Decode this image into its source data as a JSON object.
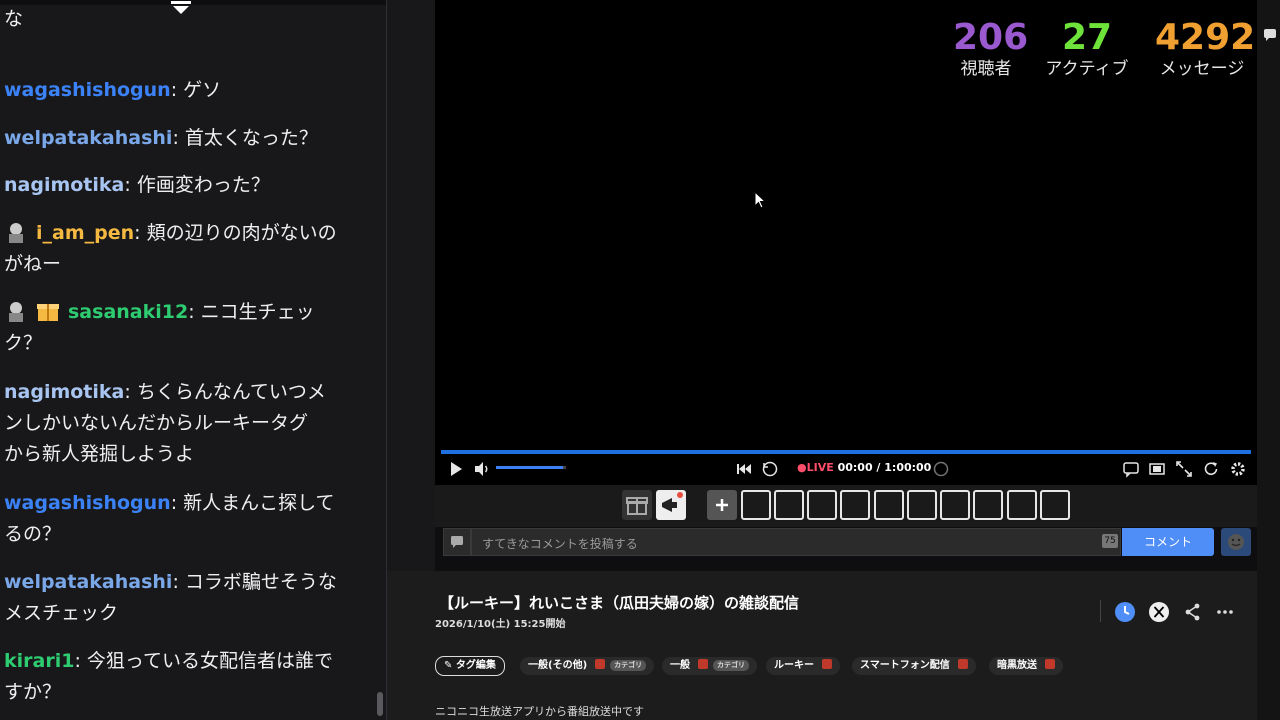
{
  "chat": {
    "messages": [
      {
        "user": "",
        "text": "な",
        "color": "#efeff1"
      },
      {
        "user": "wagashishogun",
        "text": ": ゲソ",
        "color": "#3b82f6"
      },
      {
        "user": "welpatakahashi",
        "text": ": 首太くなった？",
        "color": "#7aa7e8"
      },
      {
        "user": "nagimotika",
        "text": ": 作画変わった？",
        "color": "#a8c4f0"
      },
      {
        "user": "i_am_pen",
        "text": ": 頬の辺りの肉がないの",
        "cont": "がねー",
        "color": "#f5b942"
      },
      {
        "user": "sasanaki12",
        "text": ": ニコ生チェッ",
        "cont": "ク？",
        "color": "#2ecc71"
      },
      {
        "user": "nagimotika",
        "text": ": ちくらんなんていつメ",
        "cont": "ンしかいないんだからルーキータグ",
        "cont2": "から新人発掘しようよ",
        "color": "#a8c4f0"
      },
      {
        "user": "wagashishogun",
        "text": ": 新人まんこ探して",
        "cont": "るの？",
        "color": "#3b82f6"
      },
      {
        "user": "welpatakahashi",
        "text": ": コラボ騙せそうな",
        "cont": "メスチェック",
        "color": "#7aa7e8"
      },
      {
        "user": "kirari1",
        "text": ": 今狙っている女配信者は誰で",
        "cont": "すか？",
        "color": "#2ecc71"
      }
    ]
  },
  "stats": {
    "viewers": "206",
    "viewers_label": "視聴者",
    "active": "27",
    "active_label": "アクティブ",
    "messages": "4292",
    "messages_label": "メッセージ"
  },
  "player": {
    "live_label": "●LIVE",
    "time": "00:00 / 1:00:00",
    "volume_fraction": 0.95
  },
  "comment": {
    "placeholder": "すてきなコメントを投稿する",
    "count": "75",
    "submit_label": "コメント"
  },
  "program": {
    "title": "【ルーキー】れいこさま（瓜田夫婦の嫁）の雑談配信",
    "start": "2026/1/10(土) 15:25開始",
    "tag_edit_label": "タグ編集",
    "tags": [
      {
        "label": "一般(その他)",
        "category": "カテゴリ"
      },
      {
        "label": "一般",
        "category": "カテゴリ"
      },
      {
        "label": "ルーキー",
        "category": ""
      },
      {
        "label": "スマートフォン配信",
        "category": ""
      },
      {
        "label": "暗黒放送",
        "category": ""
      }
    ],
    "description": "ニコニコ生放送アプリから番組放送中です"
  }
}
